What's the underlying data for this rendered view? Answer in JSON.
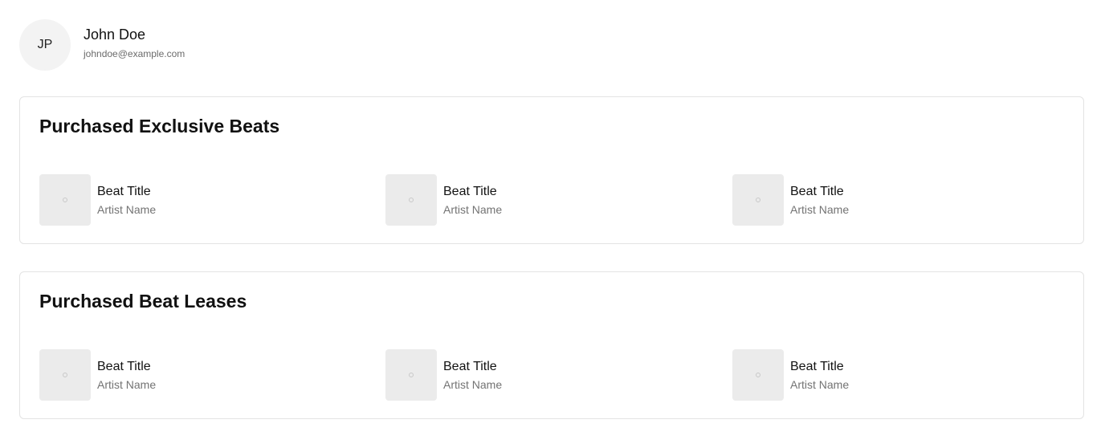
{
  "profile": {
    "initials": "JP",
    "name": "John Doe",
    "email": "johndoe@example.com"
  },
  "sections": [
    {
      "title": "Purchased Exclusive Beats",
      "items": [
        {
          "title": "Beat Title",
          "artist": "Artist Name"
        },
        {
          "title": "Beat Title",
          "artist": "Artist Name"
        },
        {
          "title": "Beat Title",
          "artist": "Artist Name"
        }
      ]
    },
    {
      "title": "Purchased Beat Leases",
      "items": [
        {
          "title": "Beat Title",
          "artist": "Artist Name"
        },
        {
          "title": "Beat Title",
          "artist": "Artist Name"
        },
        {
          "title": "Beat Title",
          "artist": "Artist Name"
        }
      ]
    }
  ],
  "icons": {
    "cover": "image-placeholder-icon"
  },
  "colors": {
    "cover_background": "#ebebeb",
    "avatar_background": "#f3f3f3",
    "card_border": "#e3e3e3",
    "muted_text": "#737373"
  }
}
